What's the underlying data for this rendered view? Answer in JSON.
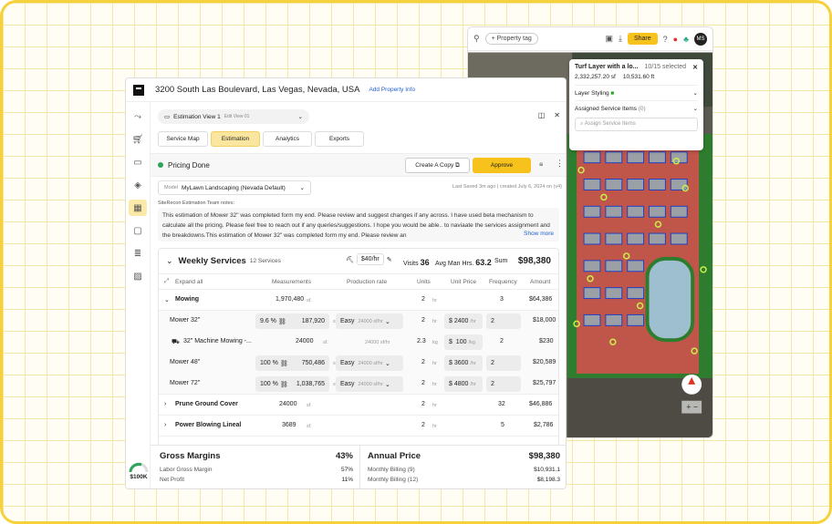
{
  "map": {
    "property_tag": "+ Property tag",
    "share_label": "Share",
    "avatar": "MS",
    "layer_panel": {
      "title": "Turf Layer with a lo...",
      "selected": "10/15 selected",
      "area": "2,332,257.20 sf",
      "length": "10,531.60 ft",
      "layer_styling": "Layer Styling",
      "assigned_label": "Assigned Service Items",
      "assigned_count": "(0)",
      "search_placeholder": "Assign Service Items"
    }
  },
  "header": {
    "address": "3200 South Las Boulevard, Las Vegas, Nevada, USA",
    "add_info": "Add Property Info"
  },
  "view": {
    "name": "Estimation View 1",
    "edit_label": "Edit View 01"
  },
  "tabs": [
    "Service Map",
    "Estimation",
    "Analytics",
    "Exports"
  ],
  "status": {
    "label": "Pricing Done",
    "copy_button": "Create A Copy",
    "approve_button": "Approve"
  },
  "model": {
    "label": "Model",
    "value": "MyLawn Landscaping (Nevada Default)"
  },
  "last_saved": "Last Saved 3m ago  |  created July 6, 2024 on (v4)",
  "notes": {
    "label": "SiteRecon Estimation Team notes:",
    "text": "This estimation of Mower 32\" was completed form my end. Please review and suggest changes if any across. I have used beta mechanism to calculate all the pricing. Please feel free to reach out if any queries/suggestions. I hope you would be able.. to naviaate the services assignment and the breakdowns.This estimation of Mower 32\" was completed form my end. Please review an",
    "show_more": "Show more"
  },
  "weekly": {
    "title": "Weekly Services",
    "count": "12 Services",
    "rate": "$40/hr",
    "visits_label": "Visits",
    "visits": "36",
    "amh_label": "Avg Man Hrs.",
    "amh": "63.2",
    "sum_label": "Sum",
    "total": "$98,380"
  },
  "columns": {
    "expand": "Expand all",
    "measurements": "Measurements",
    "production": "Production rate",
    "units": "Units",
    "unit_price": "Unit Price",
    "frequency": "Frequency",
    "amount": "Amount"
  },
  "mowing": {
    "name": "Mowing",
    "meas": "1,970,480",
    "meas_unit": "sf.",
    "units": "2",
    "units_unit": "hr",
    "freq": "3",
    "amount": "$64,386"
  },
  "subrows": [
    {
      "name": "Mower 32\"",
      "pct": "9.6 %",
      "meas": "187,920",
      "meas_unit": "sf.",
      "diff": "Easy",
      "rate": "24000 sf/hr",
      "units": "2",
      "units_unit": "hr",
      "price": "2400",
      "price_unit": "/hr",
      "freq": "2",
      "amount": "$18,000"
    },
    {
      "name": "32\" Machine Mowing -...",
      "pct": "",
      "meas": "24000",
      "meas_unit": "sf.",
      "diff": "",
      "rate": "24000 sf/hr",
      "units": "2.3",
      "units_unit": "kg",
      "price": "100",
      "price_unit": "/kg",
      "freq": "2",
      "amount": "$230"
    },
    {
      "name": "Mower 48\"",
      "pct": "100 %",
      "meas": "750,486",
      "meas_unit": "sf.",
      "diff": "Easy",
      "rate": "24000 sf/hr",
      "units": "2",
      "units_unit": "hr",
      "price": "3600",
      "price_unit": "/hr",
      "freq": "2",
      "amount": "$20,589"
    },
    {
      "name": "Mower 72\"",
      "pct": "100 %",
      "meas": "1,038,765",
      "meas_unit": "sf.",
      "diff": "Easy",
      "rate": "24000 sf/hr",
      "units": "2",
      "units_unit": "hr",
      "price": "4800",
      "price_unit": "/hr",
      "freq": "2",
      "amount": "$25,797"
    }
  ],
  "groups": [
    {
      "name": "Prune Ground Cover",
      "meas": "24000",
      "meas_unit": "sf.",
      "units": "2",
      "units_unit": "hr",
      "freq": "32",
      "amount": "$46,886"
    },
    {
      "name": "Power Blowing Lineal",
      "meas": "3689",
      "meas_unit": "sf.",
      "units": "2",
      "units_unit": "hr",
      "freq": "5",
      "amount": "$2,786"
    }
  ],
  "gross": {
    "title": "Gross Margins",
    "value": "43%",
    "labor_label": "Labor Gross Margin",
    "labor": "57%",
    "net_label": "Net Profit",
    "net": "11%"
  },
  "annual": {
    "title": "Annual Price",
    "value": "$98,380",
    "m9_label": "Monthly Billing (9)",
    "m9": "$10,931.1",
    "m12_label": "Monthly Billing (12)",
    "m12": "$8,198.3"
  },
  "gauge": "$100K"
}
